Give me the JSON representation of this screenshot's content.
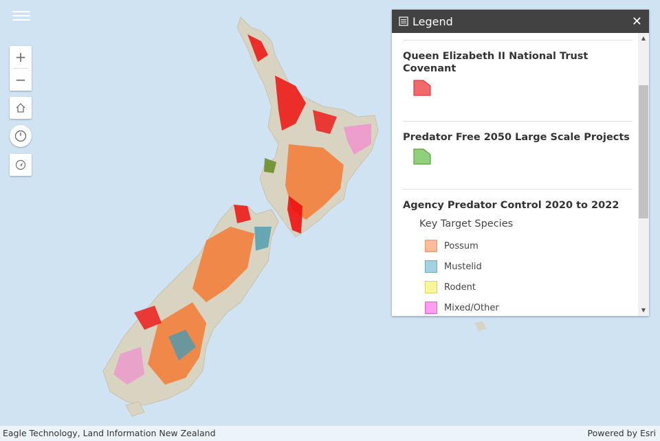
{
  "legend": {
    "title": "Legend",
    "sections": [
      {
        "title": "Queen Elizabeth II National Trust Covenant",
        "swatch_color": "#f06a6a"
      },
      {
        "title": "Predator Free 2050 Large Scale Projects",
        "swatch_color": "#8fd17a"
      },
      {
        "title": "Agency Predator Control 2020 to 2022",
        "subtitle": "Key Target Species",
        "items": [
          {
            "label": "Possum",
            "color": "#fdbb9a"
          },
          {
            "label": "Mustelid",
            "color": "#a3d3e0"
          },
          {
            "label": "Rodent",
            "color": "#f6f59a"
          },
          {
            "label": "Mixed/Other",
            "color": "#fd9ef0"
          }
        ]
      }
    ]
  },
  "icons": {
    "menu": "hamburger-icon",
    "zoom_in": "plus-icon",
    "zoom_out": "minus-icon",
    "home": "home-icon",
    "time": "power-icon",
    "locate": "locate-icon",
    "legend": "list-icon",
    "close": "close-icon"
  },
  "footer": {
    "credit": "Eagle Technology, Land Information New Zealand",
    "powered": "Powered by Esri"
  }
}
